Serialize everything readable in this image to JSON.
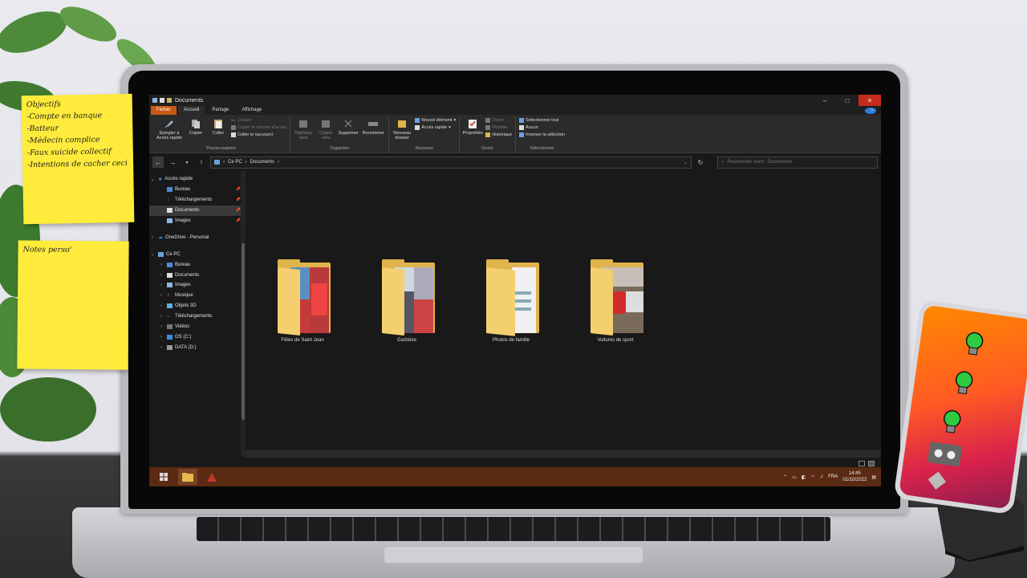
{
  "window": {
    "title": "Documents",
    "controls": {
      "minimize": "–",
      "maximize": "□",
      "close": "✕"
    }
  },
  "menu_tabs": [
    "Fichier",
    "Accueil",
    "Partage",
    "Affichage"
  ],
  "ribbon": {
    "group_clipboard": {
      "label": "Presse-papiers",
      "pin": "Épingler à Accès rapide",
      "copy": "Copier",
      "paste": "Coller",
      "cut": "Couper",
      "copy_path": "Copier le chemin d'accès",
      "paste_shortcut": "Coller le raccourci"
    },
    "group_organize": {
      "label": "Organiser",
      "move": "Déplacer vers",
      "copy_to": "Copier vers",
      "delete": "Supprimer",
      "rename": "Renommer"
    },
    "group_new": {
      "label": "Nouveau",
      "new_folder": "Nouveau dossier",
      "new_item": "Nouvel élément",
      "easy_access": "Accès rapide"
    },
    "group_open": {
      "label": "Ouvrir",
      "properties": "Propriétés",
      "open": "Ouvrir",
      "edit": "Modifier",
      "history": "Historique"
    },
    "group_select": {
      "label": "Sélectionner",
      "select_all": "Sélectionner tout",
      "select_none": "Aucun",
      "invert": "Inverser la sélection"
    }
  },
  "address": {
    "path": [
      "Ce PC",
      "Documents"
    ],
    "search_placeholder": "Rechercher dans : Documents"
  },
  "nav": {
    "quick_access": "Accès rapide",
    "quick_items": [
      "Bureau",
      "Téléchargements",
      "Documents",
      "Images"
    ],
    "onedrive": "OneDrive - Personal",
    "this_pc": "Ce PC",
    "pc_items": [
      "Bureau",
      "Documents",
      "Images",
      "Musique",
      "Objets 3D",
      "Téléchargements",
      "Vidéos",
      "OS (C:)",
      "DATA (D:)"
    ]
  },
  "folders": [
    {
      "name": "Fêtes de Saint Jean"
    },
    {
      "name": "Gaztetxe"
    },
    {
      "name": "Photos de famille"
    },
    {
      "name": "Voitures de sport"
    }
  ],
  "taskbar": {
    "language": "FRA",
    "time": "14:45",
    "date": "01/10/2022"
  },
  "sticky_notes": {
    "note1_lines": [
      "Objectifs",
      "-Compte en banque",
      "-Batteur",
      "-Médecin complice",
      "-Faux suicide collectif",
      "-Intentions de cacher ceci"
    ],
    "note2_lines": [
      "Notes perso'"
    ]
  },
  "colors": {
    "fichier_tab": "#c55a11",
    "taskbar": "#5b2a12",
    "folder": "#e0b44c",
    "sticky": "#ffeb3b"
  }
}
